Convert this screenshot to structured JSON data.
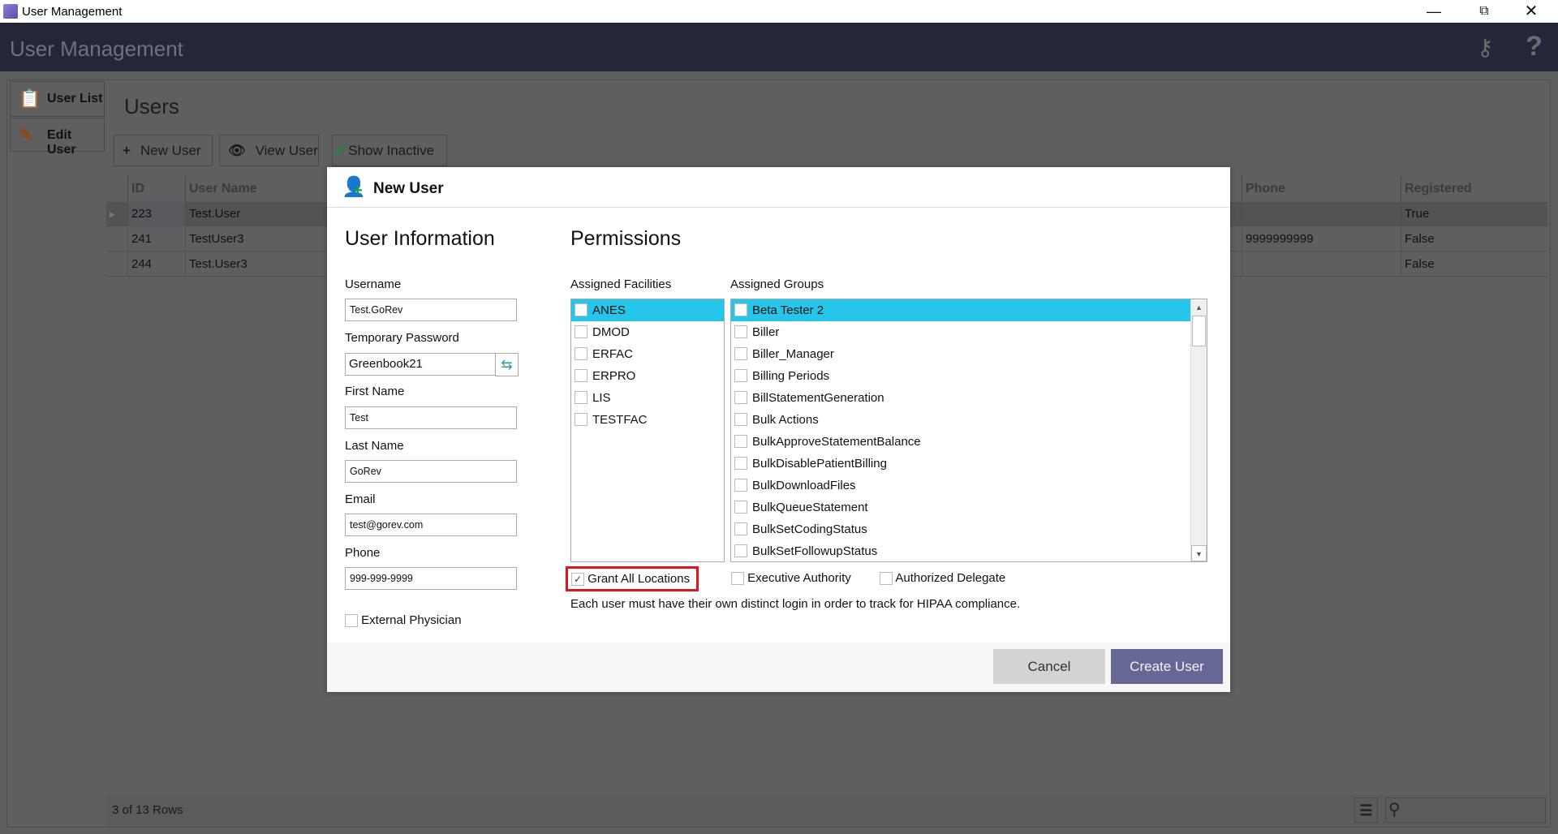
{
  "window": {
    "title": "User Management",
    "controls": [
      "minimize",
      "restore",
      "close"
    ]
  },
  "header": {
    "title": "User Management",
    "icons": [
      "keys-icon",
      "help-icon"
    ]
  },
  "sidebar": {
    "items": [
      {
        "label": "User List",
        "icon": "clipboard-icon"
      },
      {
        "label": "Edit User",
        "icon": "pencil-icon"
      }
    ]
  },
  "main": {
    "title": "Users",
    "toolbar": {
      "new_user": "New User",
      "view_user": "View User",
      "show_inactive": "Show Inactive"
    },
    "grid": {
      "columns": {
        "id": "ID",
        "user_name": "User Name",
        "phone": "Phone",
        "registered": "Registered"
      },
      "rows": [
        {
          "id": "223",
          "user_name": "Test.User",
          "phone": "",
          "registered": "True",
          "selected": true
        },
        {
          "id": "241",
          "user_name": "TestUser3",
          "phone": "9999999999",
          "registered": "False"
        },
        {
          "id": "244",
          "user_name": "Test.User3",
          "phone": "",
          "registered": "False"
        }
      ],
      "footer": "3 of 13 Rows"
    }
  },
  "dialog": {
    "title": "New User",
    "user_info": {
      "heading": "User Information",
      "username_label": "Username",
      "username": "Test.GoRev",
      "temp_password_label": "Temporary Password",
      "temp_password": "Greenbook21",
      "first_name_label": "First Name",
      "first_name": "Test",
      "last_name_label": "Last Name",
      "last_name": "GoRev",
      "email_label": "Email",
      "email": "test@gorev.com",
      "phone_label": "Phone",
      "phone": "999-999-9999",
      "external_physician_label": "External Physician",
      "external_physician": false
    },
    "permissions": {
      "heading": "Permissions",
      "facilities_label": "Assigned Facilities",
      "facilities": [
        "ANES",
        "DMOD",
        "ERFAC",
        "ERPRO",
        "LIS",
        "TESTFAC"
      ],
      "groups_label": "Assigned Groups",
      "groups": [
        "Beta Tester 2",
        "Biller",
        "Biller_Manager",
        "Billing Periods",
        "BillStatementGeneration",
        "Bulk Actions",
        "BulkApproveStatementBalance",
        "BulkDisablePatientBilling",
        "BulkDownloadFiles",
        "BulkQueueStatement",
        "BulkSetCodingStatus",
        "BulkSetFollowupStatus"
      ],
      "grant_all_label": "Grant All Locations",
      "grant_all": true,
      "executive_label": "Executive Authority",
      "executive": false,
      "delegate_label": "Authorized Delegate",
      "delegate": false,
      "note": "Each user must have their own distinct login in order to track for HIPAA compliance."
    },
    "cancel": "Cancel",
    "create": "Create User"
  },
  "colors": {
    "header": "#24263a",
    "selection": "#26c6ea",
    "primary_button": "#676796",
    "highlight_box": "#e0131f"
  }
}
